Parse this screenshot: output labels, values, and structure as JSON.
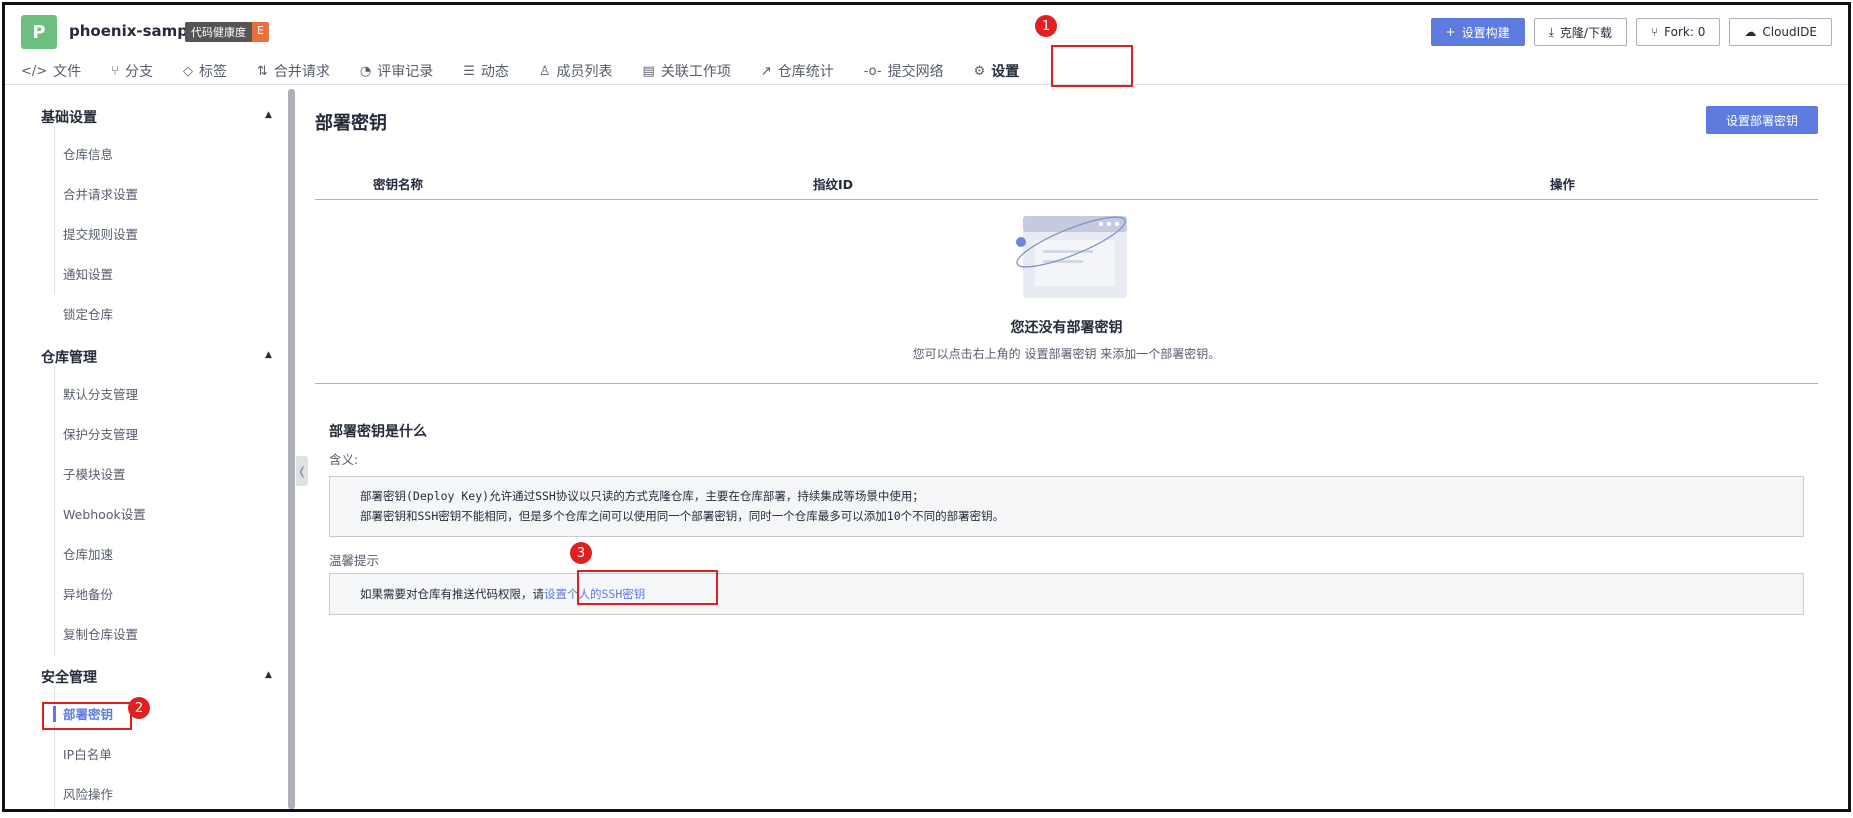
{
  "repo": {
    "avatar_letter": "P",
    "name": "phoenix-sample",
    "health_label": "代码健康度",
    "health_grade": "E"
  },
  "header_actions": [
    {
      "icon": "plus-icon",
      "glyph": "+",
      "label": "设置构建",
      "primary": true
    },
    {
      "icon": "download-icon",
      "glyph": "⤓",
      "label": "克隆/下载",
      "primary": false
    },
    {
      "icon": "fork-icon",
      "glyph": "⑂",
      "label": "Fork: 0",
      "primary": false
    },
    {
      "icon": "cloud-icon",
      "glyph": "☁",
      "label": "CloudIDE",
      "primary": false
    }
  ],
  "tabs": [
    {
      "icon": "code-icon",
      "glyph": "</>",
      "label": "文件"
    },
    {
      "icon": "branch-icon",
      "glyph": "⑂",
      "label": "分支"
    },
    {
      "icon": "tag-icon",
      "glyph": "◇",
      "label": "标签"
    },
    {
      "icon": "merge-request-icon",
      "glyph": "⇅",
      "label": "合并请求"
    },
    {
      "icon": "review-icon",
      "glyph": "◔",
      "label": "评审记录"
    },
    {
      "icon": "activity-icon",
      "glyph": "☰",
      "label": "动态"
    },
    {
      "icon": "members-icon",
      "glyph": "♙",
      "label": "成员列表"
    },
    {
      "icon": "workitem-icon",
      "glyph": "▤",
      "label": "关联工作项"
    },
    {
      "icon": "stats-icon",
      "glyph": "↗",
      "label": "仓库统计"
    },
    {
      "icon": "commit-network-icon",
      "glyph": "-o-",
      "label": "提交网络"
    },
    {
      "icon": "gear-icon",
      "glyph": "⚙",
      "label": "设置"
    }
  ],
  "sidebar": {
    "groups": [
      {
        "title": "基础设置",
        "items": [
          "仓库信息",
          "合并请求设置",
          "提交规则设置",
          "通知设置",
          "锁定仓库"
        ]
      },
      {
        "title": "仓库管理",
        "items": [
          "默认分支管理",
          "保护分支管理",
          "子模块设置",
          "Webhook设置",
          "仓库加速",
          "异地备份",
          "复制仓库设置"
        ]
      },
      {
        "title": "安全管理",
        "items": [
          "部署密钥",
          "IP白名单",
          "风险操作"
        ]
      }
    ],
    "active_item": "部署密钥"
  },
  "main": {
    "title": "部署密钥",
    "add_button": "设置部署密钥",
    "columns": [
      "密钥名称",
      "指纹ID",
      "操作"
    ],
    "empty_title": "您还没有部署密钥",
    "empty_desc": "您可以点击右上角的 设置部署密钥 来添加一个部署密钥。",
    "what_title": "部署密钥是什么",
    "meaning_label": "含义:",
    "meaning_lines": [
      "部署密钥(Deploy Key)允许通过SSH协议以只读的方式克隆仓库，主要在仓库部署，持续集成等场景中使用；",
      "部署密钥和SSH密钥不能相同，但是多个仓库之间可以使用同一个部署密钥，同时一个仓库最多可以添加10个不同的部署密钥。"
    ],
    "tip_label": "温馨提示",
    "tip_text": "如果需要对仓库有推送代码权限，请",
    "tip_link": "设置个人的SSH密钥"
  },
  "annotations": [
    "1",
    "2",
    "3"
  ],
  "colors": {
    "accent": "#5e7ce0",
    "annotation": "#e02020",
    "avatar": "#6cbf7c",
    "health_grade": "#e9703e"
  }
}
